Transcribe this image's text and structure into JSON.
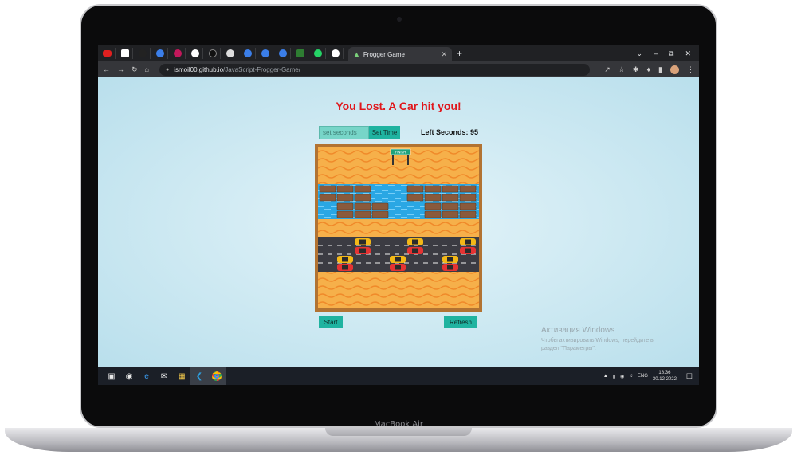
{
  "device": {
    "label": "MacBook Air"
  },
  "browser": {
    "tab_title": "Frogger Game",
    "tab_favicon": "frog-icon",
    "url_host": "ismoil00.github.io",
    "url_path": "/JavaScript-Frogger-Game/",
    "nav_icons": [
      "back-arrow-icon",
      "forward-arrow-icon",
      "reload-icon",
      "home-icon"
    ],
    "toolbar_icons": [
      "share-icon",
      "star-icon",
      "extension-icon",
      "puzzle-icon",
      "sidepanel-icon",
      "profile-avatar",
      "menu-icon"
    ]
  },
  "game": {
    "result_text": "You Lost. A Car hit you!",
    "timer_placeholder": "set seconds",
    "set_time_label": "Set Time",
    "left_seconds_label": "Left Seconds: 95",
    "finish_label": "FINISH",
    "start_label": "Start",
    "refresh_label": "Refresh",
    "colors": {
      "result": "#e0161b",
      "button": "#1fb3a0",
      "board_border": "#b27332",
      "sand": "#f6b04a",
      "water": "#2aa7e4",
      "road": "#3b3b42"
    }
  },
  "watermark": {
    "title": "Активация Windows",
    "line1": "Чтобы активировать Windows, перейдите в",
    "line2": "раздел \"Параметры\"."
  },
  "taskbar": {
    "apps": [
      "windows-start-icon",
      "search-cortana-icon",
      "edge-icon",
      "mail-icon",
      "file-explorer-icon",
      "vscode-icon",
      "chrome-icon"
    ],
    "language": "ENG",
    "time": "18:36",
    "date": "30.12.2022"
  }
}
